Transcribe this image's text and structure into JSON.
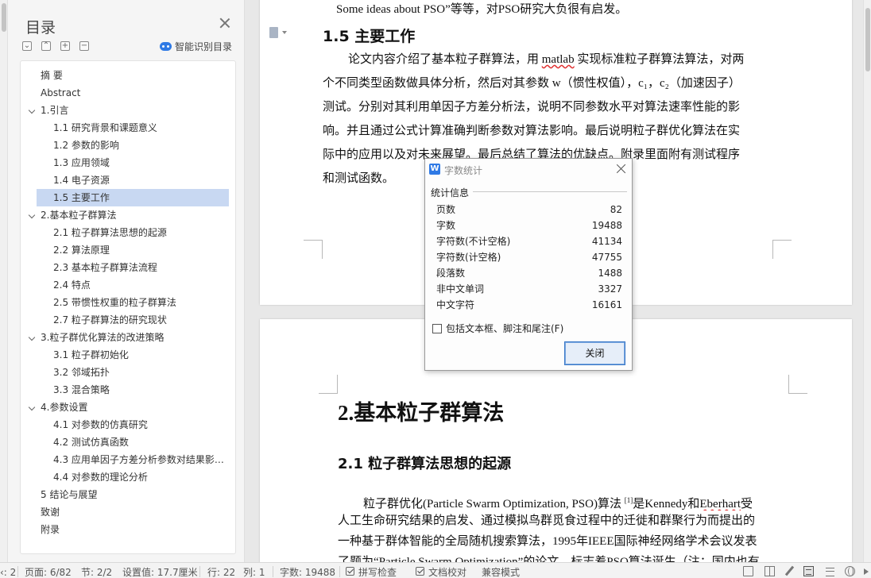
{
  "nav": {
    "title": "目录",
    "smart_toc_label": "智能识别目录",
    "items": [
      {
        "label": "摘  要",
        "level": 1,
        "expandable": false
      },
      {
        "label": "Abstract",
        "level": 1,
        "expandable": false
      },
      {
        "label": "1.引言",
        "level": 1,
        "expandable": true
      },
      {
        "label": "1.1  研究背景和课题意义",
        "level": 2
      },
      {
        "label": "1.2  参数的影响",
        "level": 2
      },
      {
        "label": "1.3  应用领域",
        "level": 2
      },
      {
        "label": "1.4  电子资源",
        "level": 2
      },
      {
        "label": "1.5  主要工作",
        "level": 2,
        "active": true
      },
      {
        "label": "2.基本粒子群算法",
        "level": 1,
        "expandable": true
      },
      {
        "label": "2.1  粒子群算法思想的起源",
        "level": 2
      },
      {
        "label": "2.2  算法原理",
        "level": 2
      },
      {
        "label": "2.3  基本粒子群算法流程",
        "level": 2
      },
      {
        "label": "2.4  特点",
        "level": 2
      },
      {
        "label": "2.5  带惯性权重的粒子群算法",
        "level": 2
      },
      {
        "label": "2.7  粒子群算法的研究现状",
        "level": 2
      },
      {
        "label": "3.粒子群优化算法的改进策略",
        "level": 1,
        "expandable": true
      },
      {
        "label": "3.1  粒子群初始化",
        "level": 2
      },
      {
        "label": "3.2  邻域拓扑",
        "level": 2
      },
      {
        "label": "3.3  混合策略",
        "level": 2
      },
      {
        "label": "4.参数设置",
        "level": 1,
        "expandable": true
      },
      {
        "label": "4.1  对参数的仿真研究",
        "level": 2
      },
      {
        "label": "4.2  测试仿真函数",
        "level": 2
      },
      {
        "label": "4.3  应用单因子方差分析参数对结果影…",
        "level": 2
      },
      {
        "label": "4.4  对参数的理论分析",
        "level": 2
      },
      {
        "label": "5 结论与展望",
        "level": 1,
        "expandable": false
      },
      {
        "label": "致谢",
        "level": 1,
        "expandable": false
      },
      {
        "label": "附录",
        "level": 1,
        "expandable": false
      }
    ]
  },
  "doc": {
    "prev_line": "Some ideas about PSO”等等，对PSO研究大负很有启发。",
    "sec15_heading": "1.5  主要工作",
    "sec15_lines": {
      "l1_pre": "论文内容介绍了基本粒子群算法，用 ",
      "l1_word": "matlab",
      "l1_post": " 实现标准粒子群算法算法，对两",
      "l2": "个不同类型函数做具体分析，然后对其参数 w（惯性权值），c₁，c₂（加速因子）",
      "l3": "测试。分别对其利用单因子方差分析法，说明不同参数水平对算法速率性能的影",
      "l4": "响。并且通过公式计算准确判断参数对算法影响。最后说明粒子群优化算法在实",
      "l5": "际中的应用以及对未来展望。最后总结了算法的优缺点。附录里面附有测试程序",
      "l6": "和测试函数。"
    },
    "sec2_heading": "2.基本粒子群算法",
    "sec21_heading": "2.1  粒子群算法思想的起源",
    "sec21_lines": {
      "l1_pre": "粒子群优化(Particle Swarm Optimization, PSO)算法 ",
      "l1_ref": "[1]",
      "l1_mid": "是Kennedy和",
      "l1_word": "Eberhart",
      "l1_post": "受",
      "l2": "人工生命研究结果的启发、通过模拟鸟群觅食过程中的迁徙和群聚行为而提出的",
      "l3": "一种基于群体智能的全局随机搜索算法，1995年IEEE国际神经网络学术会议发表",
      "l4": "了题为“Particle Swarm Optimization”的论文，标志着PSO算法诞生（注：国内也有"
    }
  },
  "dialog": {
    "icon_letter": "W",
    "title": "字数统计",
    "group_label": "统计信息",
    "stats": [
      {
        "label": "页数",
        "value": "82"
      },
      {
        "label": "字数",
        "value": "19488"
      },
      {
        "label": "字符数(不计空格)",
        "value": "41134"
      },
      {
        "label": "字符数(计空格)",
        "value": "47755"
      },
      {
        "label": "段落数",
        "value": "1488"
      },
      {
        "label": "非中文单词",
        "value": "3327"
      },
      {
        "label": "中文字符",
        "value": "16161"
      }
    ],
    "checkbox_label": "包括文本框、脚注和尾注(F)",
    "close_label": "关闭"
  },
  "status": {
    "section_cut": "‹: 2",
    "page": "页面: 6/82",
    "sect": "节: 2/2",
    "pos": "设置值: 17.7厘米",
    "row": "行: 22",
    "col": "列: 1",
    "words": "字数: 19488",
    "spell": "拼写检查",
    "proof": "文档校对",
    "compat": "兼容模式"
  },
  "colors": {
    "accent": "#2f7ae5",
    "active_toc": "#c8d8f2",
    "spell_underline": "#e03030"
  }
}
